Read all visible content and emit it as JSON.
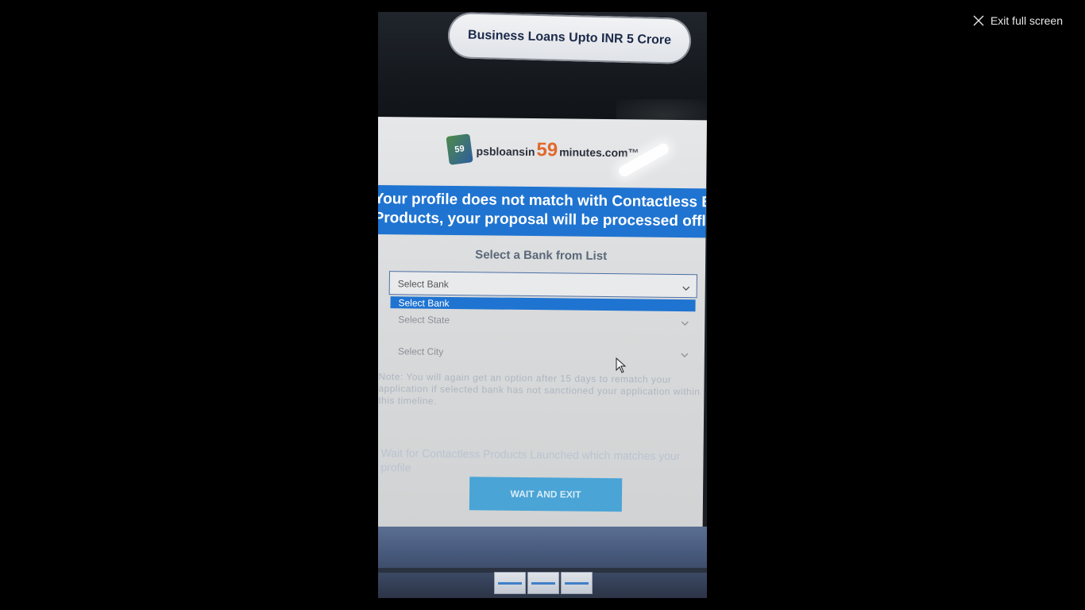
{
  "viewer": {
    "exit_label": "Exit full screen"
  },
  "photo": {
    "promo_text": "Business Loans Upto INR 5 Crore",
    "logo": {
      "badge": "59",
      "prefix": "psbloansin",
      "number": "59",
      "suffix": "minutes.com™"
    },
    "banner": {
      "line1": "Your profile does not match with Contactless Ban",
      "line2": "Products, your proposal will be processed offline"
    },
    "select_title": "Select a Bank from List",
    "bank_dropdown": {
      "value": "Select Bank",
      "highlighted_option": "Select Bank"
    },
    "state_dropdown": {
      "value": "Select State"
    },
    "city_dropdown": {
      "value": "Select City"
    },
    "note": "Note: You will again get an option after 15 days to rematch your application if selected bank has not sanctioned your application within this timeline.",
    "wait_text": "Wait for Contactless Products Launched which matches your profile",
    "wait_button": "WAIT AND EXIT"
  },
  "colors": {
    "banner_blue": "#1f74d1",
    "logo_orange": "#e2682b",
    "button_blue": "#4aa4d6"
  }
}
